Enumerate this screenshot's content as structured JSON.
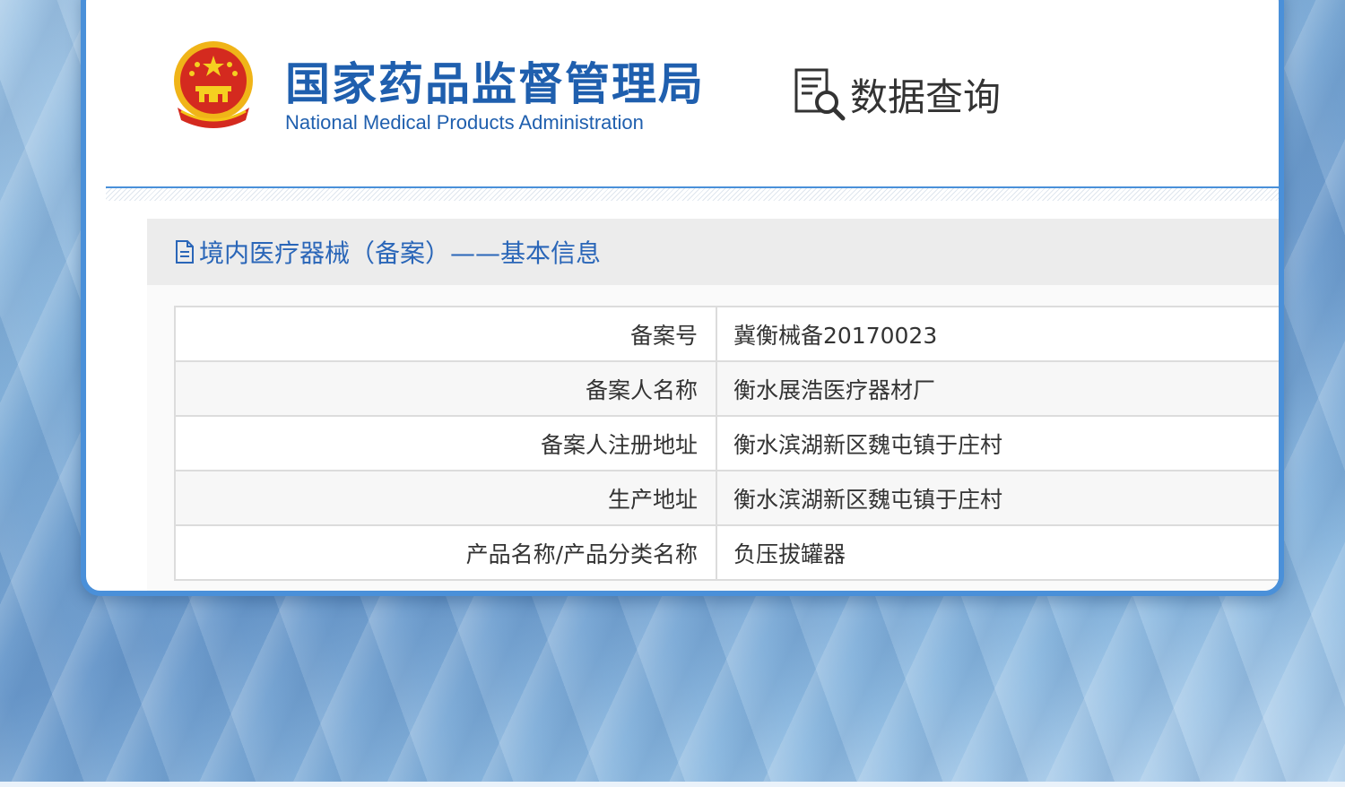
{
  "header": {
    "agency_name_cn": "国家药品监督管理局",
    "agency_name_en": "National Medical Products Administration",
    "section_title": "数据查询"
  },
  "panel": {
    "title": "境内医疗器械（备案）——基本信息"
  },
  "records": [
    {
      "label": "备案号",
      "value": "冀衡械备20170023"
    },
    {
      "label": "备案人名称",
      "value": "衡水展浩医疗器材厂"
    },
    {
      "label": "备案人注册地址",
      "value": "衡水滨湖新区魏屯镇于庄村"
    },
    {
      "label": "生产地址",
      "value": "衡水滨湖新区魏屯镇于庄村"
    },
    {
      "label": "产品名称/产品分类名称",
      "value": "负压拔罐器"
    }
  ],
  "icons": {
    "emblem": "national-emblem-icon",
    "search": "document-search-icon",
    "panel": "document-icon"
  },
  "colors": {
    "brand_blue": "#1f5fae",
    "card_border": "#4a90d9",
    "panel_title": "#2a66b8",
    "emblem_red": "#d42a1f",
    "emblem_gold": "#f5c518"
  }
}
